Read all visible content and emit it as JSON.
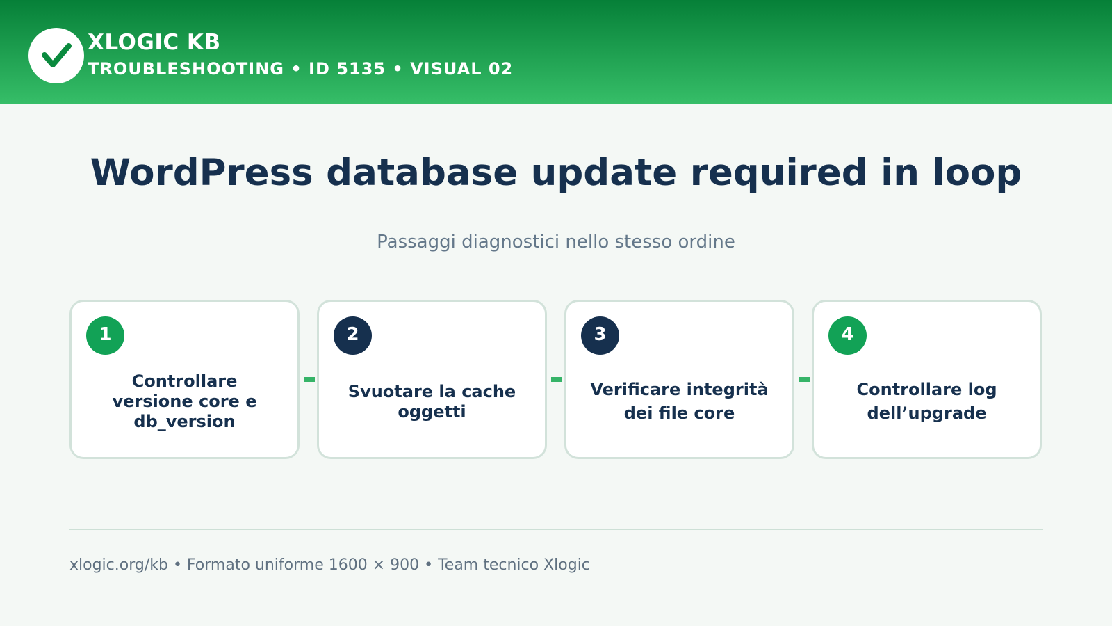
{
  "header": {
    "brand": "XLOGIC KB",
    "subtitle": "TROUBLESHOOTING • ID 5135 • VISUAL 02",
    "logo_icon": "check-icon"
  },
  "main": {
    "title": "WordPress database update required in loop",
    "subtitle": "Passaggi diagnostici nello stesso ordine"
  },
  "steps": [
    {
      "number": "1",
      "label": "Controllare versione core e db_version",
      "badge_color": "#12a256"
    },
    {
      "number": "2",
      "label": "Svuotare la cache oggetti",
      "badge_color": "#16304e"
    },
    {
      "number": "3",
      "label": "Verificare integrità dei file core",
      "badge_color": "#16304e"
    },
    {
      "number": "4",
      "label": "Controllare log dell’upgrade",
      "badge_color": "#12a256"
    }
  ],
  "footer": {
    "text": "xlogic.org/kb • Formato uniforme 1600 × 900 • Team tecnico Xlogic"
  },
  "colors": {
    "header_top": "#068038",
    "header_bottom": "#36be68",
    "accent_green": "#12a256",
    "navy": "#16304e",
    "background": "#f4f8f5"
  }
}
